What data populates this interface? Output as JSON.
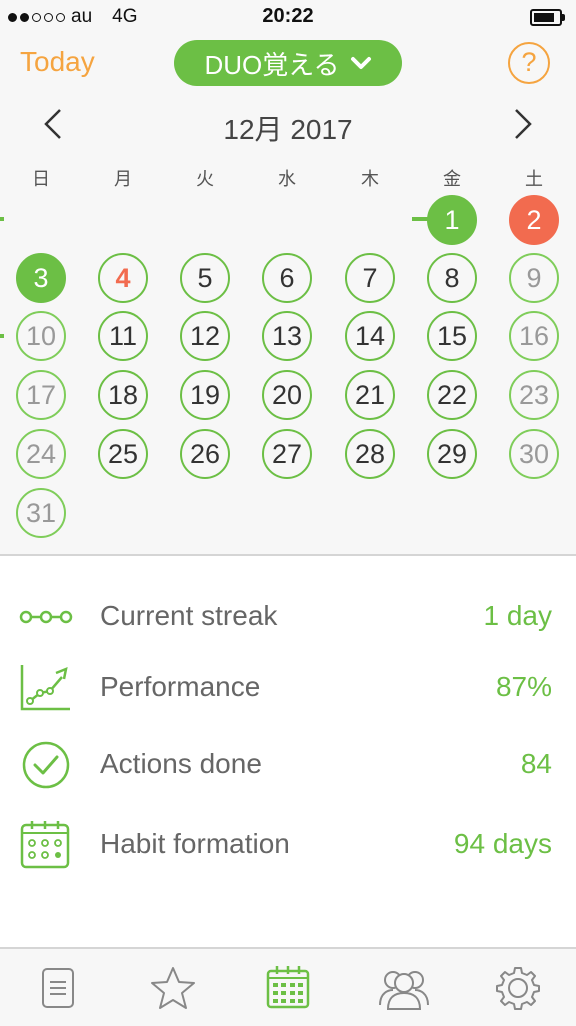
{
  "status_bar": {
    "carrier": "au",
    "network": "4G",
    "time": "20:22"
  },
  "header": {
    "today_label": "Today",
    "habit_name": "DUO覚える",
    "help_label": "?"
  },
  "calendar": {
    "month_label": "12月 2017",
    "weekdays": [
      "日",
      "月",
      "火",
      "水",
      "木",
      "金",
      "土"
    ],
    "days": [
      "1",
      "2",
      "3",
      "4",
      "5",
      "6",
      "7",
      "8",
      "9",
      "10",
      "11",
      "12",
      "13",
      "14",
      "15",
      "16",
      "17",
      "18",
      "19",
      "20",
      "21",
      "22",
      "23",
      "24",
      "25",
      "26",
      "27",
      "28",
      "29",
      "30",
      "31"
    ]
  },
  "stats": [
    {
      "label": "Current streak",
      "value": "1 day",
      "icon": "streak-icon"
    },
    {
      "label": "Performance",
      "value": "87%",
      "icon": "performance-chart-icon"
    },
    {
      "label": "Actions done",
      "value": "84",
      "icon": "checkmark-circle-icon"
    },
    {
      "label": "Habit formation",
      "value": "94 days",
      "icon": "calendar-grid-icon"
    }
  ],
  "tabs": [
    "list-icon",
    "star-icon",
    "calendar-icon",
    "friends-icon",
    "settings-gear-icon"
  ],
  "colors": {
    "accent": "#6cbf45",
    "orange": "#f5a440",
    "missed": "#f26b4f"
  }
}
